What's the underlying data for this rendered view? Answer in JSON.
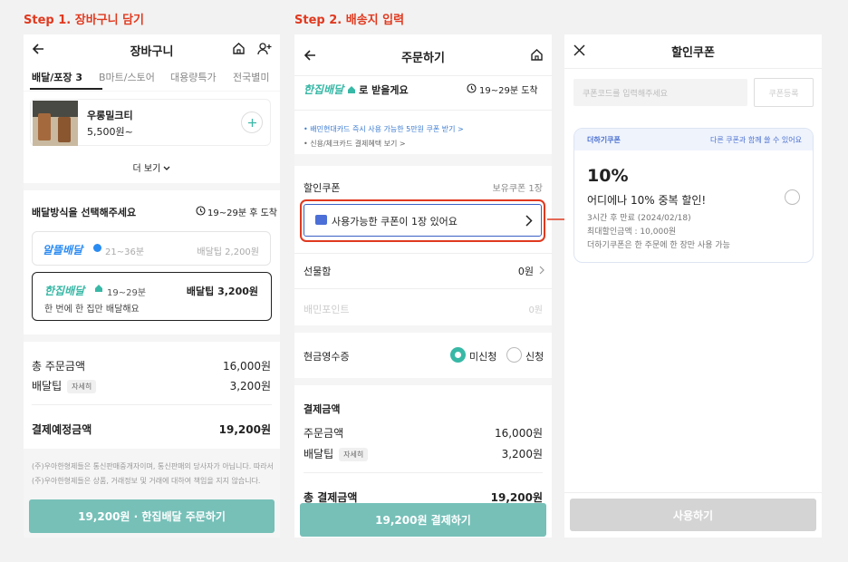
{
  "steps": {
    "step1": "Step 1. 장바구니 담기",
    "step2": "Step 2. 배송지 입력"
  },
  "cart": {
    "title": "장바구니",
    "tabs": [
      "배달/포장 3",
      "B마트/스토어",
      "대용량특가",
      "전국별미"
    ],
    "item": {
      "name": "우롱밀크티",
      "price": "5,500원~"
    },
    "more": "더 보기",
    "delivery_method": {
      "heading": "배달방식을 선택해주세요",
      "eta": "19~29분 후 도착",
      "options": [
        {
          "brand": "알뜰배달",
          "time": "21~36분",
          "tip": "배달팁 2,200원",
          "desc": ""
        },
        {
          "brand": "한집배달",
          "time": "19~29분",
          "tip": "배달팁 3,200원",
          "desc": "한 번에 한 집만 배달해요"
        }
      ]
    },
    "summary": {
      "order_label": "총 주문금액",
      "order_value": "16,000원",
      "tip_label": "배달팁",
      "tip_chip": "자세히",
      "tip_value": "3,200원",
      "total_label": "결제예정금액",
      "total_value": "19,200원"
    },
    "notice": "(주)우아한형제들은 통신판매중개자이며, 통신판매의 당사자가 아닙니다. 따라서 (주)우아한형제들은 상품, 거래정보 및 거래에 대하여 책임을 지지 않습니다.",
    "cta": "19,200원 · 한집배달 주문하기"
  },
  "order": {
    "title": "주문하기",
    "receive_brand": "한집배달",
    "receive_suffix": "로 받을게요",
    "eta": "19~29분 도착",
    "promo1": "• 배민현대카드 즉시 사용 가능한 5만원 쿠폰 받기 >",
    "promo2": "• 신용/체크카드 결제혜택 보기 >",
    "coupon_label": "할인쿠폰",
    "coupon_owned": "보유쿠폰 1장",
    "coupon_button": "사용가능한 쿠폰이 1장 있어요",
    "gift_label": "선물함",
    "gift_value": "0원",
    "point_label": "배민포인트",
    "point_value": "0원",
    "receipt_label": "현금영수증",
    "receipt_opt1": "미신청",
    "receipt_opt2": "신청",
    "pay_heading": "결제금액",
    "order_label": "주문금액",
    "order_value": "16,000원",
    "tip_label": "배달팁",
    "tip_chip": "자세히",
    "tip_value": "3,200원",
    "cut_label": "총 결제금액",
    "cut_value": "19,200원",
    "cta": "19,200원 결제하기"
  },
  "coupon": {
    "title": "할인쿠폰",
    "code_placeholder": "쿠폰코드를 입력해주세요",
    "register": "쿠폰등록",
    "tag": "더하기쿠폰",
    "tag_note": "다른 쿠폰과 함께 쓸 수 있어요",
    "amount": "10%",
    "name": "어디에나 10% 중복 할인!",
    "expiry": "3시간 후 만료 (2024/02/18)",
    "max": "최대할인금액 : 10,000원",
    "rule": "더하기쿠폰은 한 주문에 한 장만 사용 가능",
    "cta": "사용하기"
  },
  "colors": {
    "accent_red": "#e0391f",
    "teal": "#38b8a6",
    "cta_teal": "#76c0b8",
    "alddl_blue": "#2a8bf2"
  }
}
